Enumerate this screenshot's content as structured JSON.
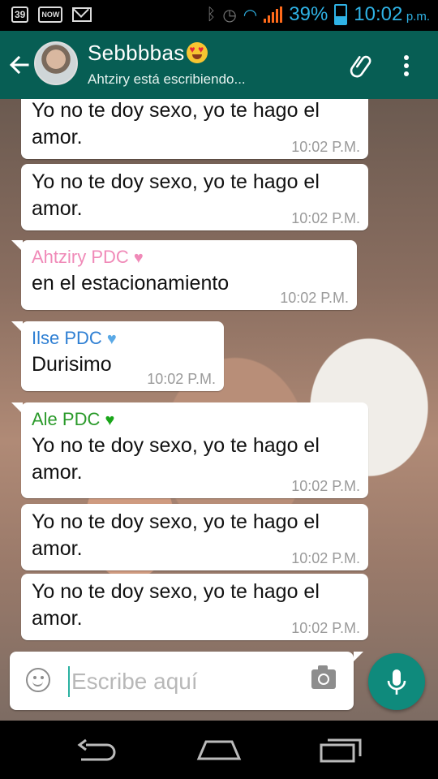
{
  "status_bar": {
    "badge_left": "39",
    "badge_now": "NOW",
    "battery_percent": "39%",
    "time": "10:02",
    "ampm": "p.m."
  },
  "header": {
    "contact_name": "Sebbbbas",
    "status": "Ahtziry está escribiendo..."
  },
  "messages": [
    {
      "sender": "",
      "text": "Yo no te doy sexo, yo te hago el amor.",
      "time": "10:02 P.M."
    },
    {
      "sender": "",
      "text": "Yo no te doy sexo, yo te hago el amor.",
      "time": "10:02 P.M."
    },
    {
      "sender": "Ahtziry PDC",
      "sender_color": "#f08ab8",
      "heart": "♥",
      "heart_color": "#f08ab8",
      "text": "en el estacionamiento",
      "time": "10:02 P.M."
    },
    {
      "sender": "Ilse PDC",
      "sender_color": "#2e7fd3",
      "heart": "♥",
      "heart_color": "#5aa9e6",
      "text": "Durisimo",
      "time": "10:02 P.M."
    },
    {
      "sender": "Ale PDC",
      "sender_color": "#2a9a2a",
      "heart": "♥",
      "heart_color": "#1aa61a",
      "text": "Yo no te doy sexo, yo te hago el amor.",
      "time": "10:02 P.M."
    },
    {
      "sender": "",
      "text": "Yo no te doy sexo, yo te hago el amor.",
      "time": "10:02 P.M."
    },
    {
      "sender": "",
      "text": "Yo no te doy sexo, yo te hago el amor.",
      "time": "10:02 P.M."
    }
  ],
  "input": {
    "placeholder": "Escribe aquí"
  },
  "colors": {
    "header_bg": "#075e54",
    "mic_bg": "#0f8a7c",
    "status_accent": "#2fb3e6"
  },
  "icons": [
    "back-arrow-icon",
    "attach-icon",
    "more-vert-icon",
    "emoji-icon",
    "camera-icon",
    "mic-icon",
    "nav-back-icon",
    "nav-home-icon",
    "nav-recent-icon"
  ]
}
